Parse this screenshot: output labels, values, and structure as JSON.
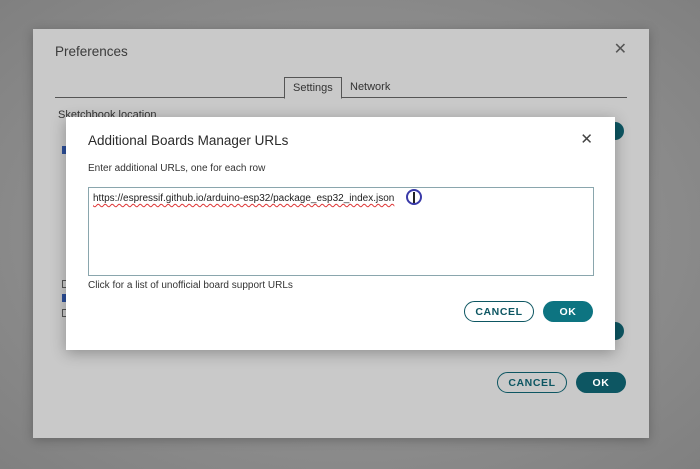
{
  "preferences": {
    "title": "Preferences",
    "close_glyph": "✕",
    "tabs": [
      {
        "label": "Settings",
        "active": true
      },
      {
        "label": "Network",
        "active": false
      }
    ],
    "sketchbook_label": "Sketchbook location",
    "cancel_label": "CANCEL",
    "ok_label": "OK"
  },
  "dialog": {
    "title": "Additional Boards Manager URLs",
    "close_glyph": "✕",
    "instructions": "Enter additional URLs, one for each row",
    "urls_value": "https://espressif.github.io/arduino-esp32/package_esp32_index.json",
    "help_link": "Click for a list of unofficial board support URLs",
    "cancel_label": "CANCEL",
    "ok_label": "OK"
  },
  "colors": {
    "accent": "#0d5662",
    "ok_button": "#0d7481",
    "backdrop": "#8a8a8a"
  },
  "icons": {
    "close": "close-icon",
    "cursor": "text-cursor-icon"
  }
}
